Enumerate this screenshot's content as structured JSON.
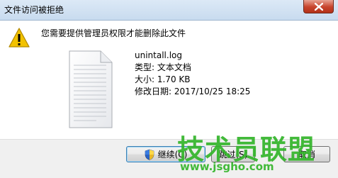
{
  "window": {
    "title": "文件访问被拒绝"
  },
  "message": "您需要提供管理员权限才能删除此文件",
  "file": {
    "name": "unintall.log",
    "type_line": "类型: 文本文档",
    "size_line": "大小: 1.70 KB",
    "date_line": "修改日期: 2017/10/25 18:25",
    "icon": "text-document-icon"
  },
  "buttons": {
    "continue": "继续(C)",
    "skip": "跳过(S)",
    "cancel": "取消"
  },
  "watermark": {
    "text": "技术员联盟",
    "url": "www.jsgho.com"
  },
  "colors": {
    "watermark": "#33b52a",
    "close_button": "#c7432b",
    "warning": "#f2c200"
  }
}
